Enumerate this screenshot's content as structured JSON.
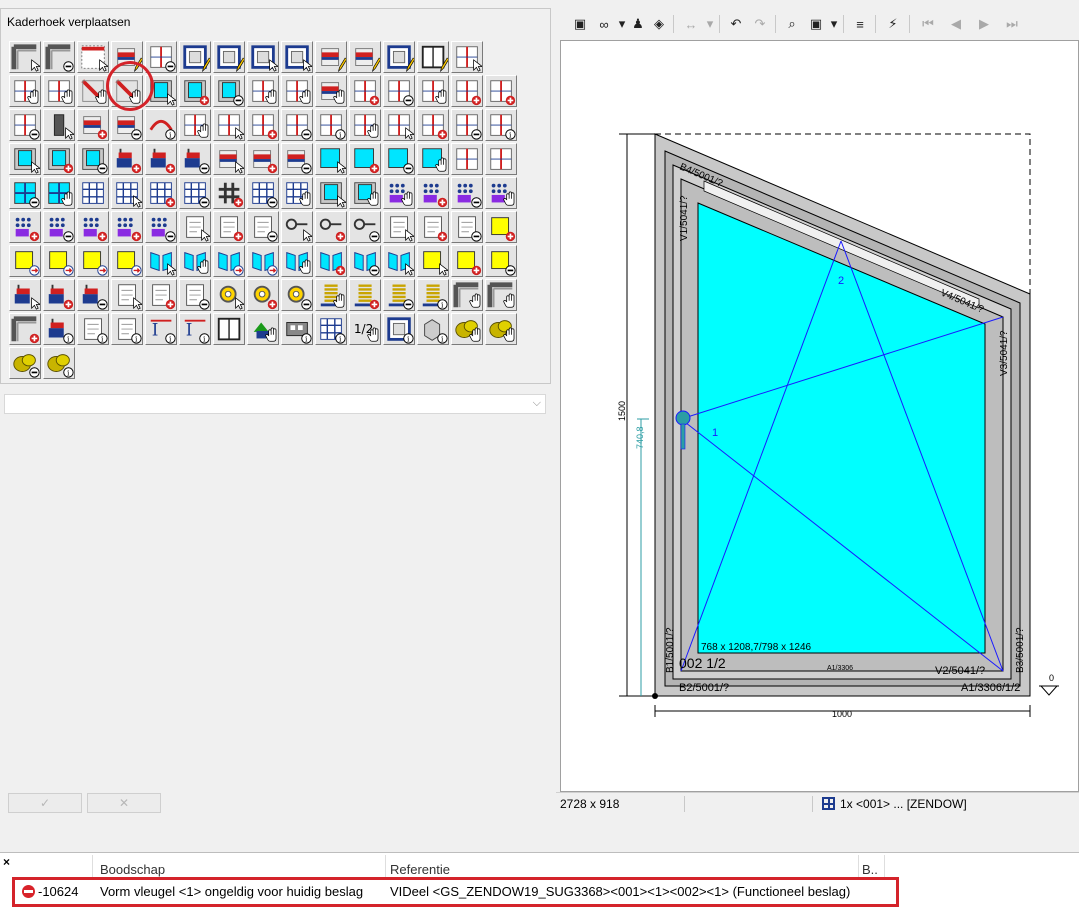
{
  "palette": {
    "title": "Kaderhoek verplaatsen",
    "tools": [
      {
        "row": 0,
        "col": 0,
        "kind": "corner",
        "badge": "cursor"
      },
      {
        "row": 0,
        "col": 1,
        "kind": "corner",
        "badge": "minus"
      },
      {
        "row": 0,
        "col": 2,
        "kind": "frame-red",
        "badge": "cursor"
      },
      {
        "row": 0,
        "col": 3,
        "kind": "bar-red",
        "badge": "pencil"
      },
      {
        "row": 0,
        "col": 4,
        "kind": "split",
        "badge": "minus"
      },
      {
        "row": 0,
        "col": 5,
        "kind": "frame-blue",
        "badge": "pencil"
      },
      {
        "row": 0,
        "col": 6,
        "kind": "frame-blue",
        "badge": "pencil"
      },
      {
        "row": 0,
        "col": 7,
        "kind": "frame-blue",
        "badge": "cursor"
      },
      {
        "row": 0,
        "col": 8,
        "kind": "frame-blue",
        "badge": "cursor"
      },
      {
        "row": 0,
        "col": 9,
        "kind": "bar-red",
        "badge": "pencil"
      },
      {
        "row": 0,
        "col": 10,
        "kind": "bar-red",
        "badge": "pencil"
      },
      {
        "row": 0,
        "col": 11,
        "kind": "frame-blue",
        "badge": "pencil"
      },
      {
        "row": 0,
        "col": 12,
        "kind": "window",
        "badge": "pencil"
      },
      {
        "row": 0,
        "col": 13,
        "kind": "split",
        "badge": "cursor"
      },
      {
        "row": 1,
        "col": 0,
        "kind": "split",
        "badge": "hand"
      },
      {
        "row": 1,
        "col": 1,
        "kind": "split",
        "badge": "hand"
      },
      {
        "row": 1,
        "col": 2,
        "kind": "diag-red",
        "badge": "hand"
      },
      {
        "row": 1,
        "col": 3,
        "kind": "diag-red",
        "badge": "hand"
      },
      {
        "row": 1,
        "col": 4,
        "kind": "cyan-frame",
        "badge": "cursor"
      },
      {
        "row": 1,
        "col": 5,
        "kind": "cyan-frame",
        "badge": "plus"
      },
      {
        "row": 1,
        "col": 6,
        "kind": "cyan-frame",
        "badge": "minus"
      },
      {
        "row": 1,
        "col": 7,
        "kind": "split",
        "badge": "hand"
      },
      {
        "row": 1,
        "col": 8,
        "kind": "split",
        "badge": "hand"
      },
      {
        "row": 1,
        "col": 9,
        "kind": "bar-red",
        "badge": "hand"
      },
      {
        "row": 1,
        "col": 10,
        "kind": "split",
        "badge": "plus"
      },
      {
        "row": 1,
        "col": 11,
        "kind": "split",
        "badge": "minus"
      },
      {
        "row": 1,
        "col": 12,
        "kind": "split",
        "badge": "hand"
      },
      {
        "row": 1,
        "col": 13,
        "kind": "split",
        "badge": "plus"
      },
      {
        "row": 1,
        "col": 14,
        "kind": "split",
        "badge": "plus"
      },
      {
        "row": 2,
        "col": 0,
        "kind": "split",
        "badge": "minus"
      },
      {
        "row": 2,
        "col": 1,
        "kind": "bar-dark",
        "badge": "cursor"
      },
      {
        "row": 2,
        "col": 2,
        "kind": "bar-red",
        "badge": "plus"
      },
      {
        "row": 2,
        "col": 3,
        "kind": "bar-red",
        "badge": "minus"
      },
      {
        "row": 2,
        "col": 4,
        "kind": "arc",
        "badge": "info"
      },
      {
        "row": 2,
        "col": 5,
        "kind": "split",
        "badge": "hand"
      },
      {
        "row": 2,
        "col": 6,
        "kind": "split",
        "badge": "cursor"
      },
      {
        "row": 2,
        "col": 7,
        "kind": "split",
        "badge": "plus"
      },
      {
        "row": 2,
        "col": 8,
        "kind": "split",
        "badge": "minus"
      },
      {
        "row": 2,
        "col": 9,
        "kind": "split",
        "badge": "info"
      },
      {
        "row": 2,
        "col": 10,
        "kind": "split",
        "badge": "hand"
      },
      {
        "row": 2,
        "col": 11,
        "kind": "split",
        "badge": "cursor"
      },
      {
        "row": 2,
        "col": 12,
        "kind": "split",
        "badge": "plus"
      },
      {
        "row": 2,
        "col": 13,
        "kind": "split",
        "badge": "minus"
      },
      {
        "row": 2,
        "col": 14,
        "kind": "split",
        "badge": "info"
      },
      {
        "row": 3,
        "col": 0,
        "kind": "cyan-frame",
        "badge": "cursor"
      },
      {
        "row": 3,
        "col": 1,
        "kind": "cyan-frame",
        "badge": "plus"
      },
      {
        "row": 3,
        "col": 2,
        "kind": "cyan-frame",
        "badge": "minus"
      },
      {
        "row": 3,
        "col": 3,
        "kind": "stack",
        "badge": "plus"
      },
      {
        "row": 3,
        "col": 4,
        "kind": "stack",
        "badge": "plus"
      },
      {
        "row": 3,
        "col": 5,
        "kind": "stack",
        "badge": "minus"
      },
      {
        "row": 3,
        "col": 6,
        "kind": "bar-red",
        "badge": "cursor"
      },
      {
        "row": 3,
        "col": 7,
        "kind": "bar-red",
        "badge": "plus"
      },
      {
        "row": 3,
        "col": 8,
        "kind": "bar-red",
        "badge": "minus"
      },
      {
        "row": 3,
        "col": 9,
        "kind": "cyan",
        "badge": "cursor"
      },
      {
        "row": 3,
        "col": 10,
        "kind": "cyan",
        "badge": "plus"
      },
      {
        "row": 3,
        "col": 11,
        "kind": "cyan",
        "badge": "minus"
      },
      {
        "row": 3,
        "col": 12,
        "kind": "cyan",
        "badge": "hand"
      },
      {
        "row": 3,
        "col": 13,
        "kind": "split",
        "badge": "none"
      },
      {
        "row": 3,
        "col": 14,
        "kind": "split",
        "badge": "none"
      },
      {
        "row": 4,
        "col": 0,
        "kind": "cyan-cross",
        "badge": "minus"
      },
      {
        "row": 4,
        "col": 1,
        "kind": "cyan-cross",
        "badge": "hand"
      },
      {
        "row": 4,
        "col": 2,
        "kind": "grid",
        "badge": "none"
      },
      {
        "row": 4,
        "col": 3,
        "kind": "grid",
        "badge": "cursor"
      },
      {
        "row": 4,
        "col": 4,
        "kind": "grid",
        "badge": "plus"
      },
      {
        "row": 4,
        "col": 5,
        "kind": "grid",
        "badge": "minus"
      },
      {
        "row": 4,
        "col": 6,
        "kind": "grid-dark",
        "badge": "plus"
      },
      {
        "row": 4,
        "col": 7,
        "kind": "grid",
        "badge": "minus"
      },
      {
        "row": 4,
        "col": 8,
        "kind": "grid",
        "badge": "hand"
      },
      {
        "row": 4,
        "col": 9,
        "kind": "cyan-frame",
        "badge": "cursor"
      },
      {
        "row": 4,
        "col": 10,
        "kind": "cyan-frame",
        "badge": "hand"
      },
      {
        "row": 4,
        "col": 11,
        "kind": "dots",
        "badge": "hand"
      },
      {
        "row": 4,
        "col": 12,
        "kind": "dots",
        "badge": "plus"
      },
      {
        "row": 4,
        "col": 13,
        "kind": "dots",
        "badge": "minus"
      },
      {
        "row": 4,
        "col": 14,
        "kind": "dots",
        "badge": "hand"
      },
      {
        "row": 5,
        "col": 0,
        "kind": "dots",
        "badge": "plus"
      },
      {
        "row": 5,
        "col": 1,
        "kind": "dots",
        "badge": "minus"
      },
      {
        "row": 5,
        "col": 2,
        "kind": "dots",
        "badge": "plus"
      },
      {
        "row": 5,
        "col": 3,
        "kind": "dots",
        "badge": "plus"
      },
      {
        "row": 5,
        "col": 4,
        "kind": "dots",
        "badge": "minus"
      },
      {
        "row": 5,
        "col": 5,
        "kind": "sheet",
        "badge": "cursor"
      },
      {
        "row": 5,
        "col": 6,
        "kind": "sheet",
        "badge": "plus"
      },
      {
        "row": 5,
        "col": 7,
        "kind": "sheet",
        "badge": "minus"
      },
      {
        "row": 5,
        "col": 8,
        "kind": "key",
        "badge": "cursor"
      },
      {
        "row": 5,
        "col": 9,
        "kind": "key",
        "badge": "plus"
      },
      {
        "row": 5,
        "col": 10,
        "kind": "key",
        "badge": "minus"
      },
      {
        "row": 5,
        "col": 11,
        "kind": "sheet",
        "badge": "cursor"
      },
      {
        "row": 5,
        "col": 12,
        "kind": "sheet",
        "badge": "plus"
      },
      {
        "row": 5,
        "col": 13,
        "kind": "sheet",
        "badge": "minus"
      },
      {
        "row": 5,
        "col": 14,
        "kind": "yellow",
        "badge": "plus"
      },
      {
        "row": 6,
        "col": 0,
        "kind": "yellow",
        "badge": "arrow"
      },
      {
        "row": 6,
        "col": 1,
        "kind": "yellow",
        "badge": "arrow"
      },
      {
        "row": 6,
        "col": 2,
        "kind": "yellow",
        "badge": "arrow"
      },
      {
        "row": 6,
        "col": 3,
        "kind": "yellow",
        "badge": "arrow"
      },
      {
        "row": 6,
        "col": 4,
        "kind": "book",
        "badge": "cursor"
      },
      {
        "row": 6,
        "col": 5,
        "kind": "book",
        "badge": "hand"
      },
      {
        "row": 6,
        "col": 6,
        "kind": "book",
        "badge": "arrow"
      },
      {
        "row": 6,
        "col": 7,
        "kind": "book",
        "badge": "arrow"
      },
      {
        "row": 6,
        "col": 8,
        "kind": "book",
        "badge": "hand"
      },
      {
        "row": 6,
        "col": 9,
        "kind": "book",
        "badge": "plus"
      },
      {
        "row": 6,
        "col": 10,
        "kind": "book",
        "badge": "minus"
      },
      {
        "row": 6,
        "col": 11,
        "kind": "book",
        "badge": "cursor"
      },
      {
        "row": 6,
        "col": 12,
        "kind": "yellow",
        "badge": "cursor"
      },
      {
        "row": 6,
        "col": 13,
        "kind": "yellow",
        "badge": "plus"
      },
      {
        "row": 6,
        "col": 14,
        "kind": "yellow",
        "badge": "minus"
      },
      {
        "row": 7,
        "col": 0,
        "kind": "stack",
        "badge": "cursor"
      },
      {
        "row": 7,
        "col": 1,
        "kind": "stack",
        "badge": "plus"
      },
      {
        "row": 7,
        "col": 2,
        "kind": "stack",
        "badge": "minus"
      },
      {
        "row": 7,
        "col": 3,
        "kind": "sheet",
        "badge": "cursor"
      },
      {
        "row": 7,
        "col": 4,
        "kind": "sheet",
        "badge": "plus"
      },
      {
        "row": 7,
        "col": 5,
        "kind": "sheet",
        "badge": "minus"
      },
      {
        "row": 7,
        "col": 6,
        "kind": "gear",
        "badge": "cursor"
      },
      {
        "row": 7,
        "col": 7,
        "kind": "gear",
        "badge": "plus"
      },
      {
        "row": 7,
        "col": 8,
        "kind": "gear",
        "badge": "minus"
      },
      {
        "row": 7,
        "col": 9,
        "kind": "spring",
        "badge": "hand"
      },
      {
        "row": 7,
        "col": 10,
        "kind": "spring",
        "badge": "plus"
      },
      {
        "row": 7,
        "col": 11,
        "kind": "spring",
        "badge": "minus"
      },
      {
        "row": 7,
        "col": 12,
        "kind": "spring",
        "badge": "info"
      },
      {
        "row": 7,
        "col": 13,
        "kind": "corner",
        "badge": "hand"
      },
      {
        "row": 7,
        "col": 14,
        "kind": "corner",
        "badge": "hand"
      },
      {
        "row": 8,
        "col": 0,
        "kind": "corner",
        "badge": "plus"
      },
      {
        "row": 8,
        "col": 1,
        "kind": "stack",
        "badge": "info"
      },
      {
        "row": 8,
        "col": 2,
        "kind": "sheet",
        "badge": "info"
      },
      {
        "row": 8,
        "col": 3,
        "kind": "sheet",
        "badge": "info"
      },
      {
        "row": 8,
        "col": 4,
        "kind": "ibeam",
        "badge": "info"
      },
      {
        "row": 8,
        "col": 5,
        "kind": "ibeam",
        "badge": "info"
      },
      {
        "row": 8,
        "col": 6,
        "kind": "window",
        "badge": "none"
      },
      {
        "row": 8,
        "col": 7,
        "kind": "green",
        "badge": "hand"
      },
      {
        "row": 8,
        "col": 8,
        "kind": "profile",
        "badge": "info"
      },
      {
        "row": 8,
        "col": 9,
        "kind": "grid",
        "badge": "info"
      },
      {
        "row": 8,
        "col": 10,
        "kind": "half",
        "badge": "hand"
      },
      {
        "row": 8,
        "col": 11,
        "kind": "frame-blue",
        "badge": "info"
      },
      {
        "row": 8,
        "col": 12,
        "kind": "box",
        "badge": "info"
      },
      {
        "row": 8,
        "col": 13,
        "kind": "coins",
        "badge": "hand"
      },
      {
        "row": 8,
        "col": 14,
        "kind": "coins",
        "badge": "hand"
      },
      {
        "row": 9,
        "col": 0,
        "kind": "coins",
        "badge": "minus"
      },
      {
        "row": 9,
        "col": 1,
        "kind": "coins",
        "badge": "info"
      }
    ]
  },
  "toolbar": {
    "items": [
      {
        "name": "view-button-icon",
        "glyph": "▣",
        "disabled": false
      },
      {
        "name": "glasses-icon",
        "glyph": "∞",
        "disabled": false
      },
      {
        "name": "dropdown-arrow-icon",
        "glyph": "▾",
        "disabled": false
      },
      {
        "name": "person-icon",
        "glyph": "♟",
        "disabled": false
      },
      {
        "name": "layers-icon",
        "glyph": "◈",
        "disabled": false
      },
      {
        "name": "dimension-icon",
        "glyph": "↔",
        "disabled": true
      },
      {
        "name": "dropdown-arrow-icon",
        "glyph": "▾",
        "disabled": true
      },
      {
        "name": "undo-icon",
        "glyph": "↶",
        "disabled": false
      },
      {
        "name": "redo-icon",
        "glyph": "↷",
        "disabled": true
      },
      {
        "name": "zoom-icon",
        "glyph": "⌕",
        "disabled": false
      },
      {
        "name": "frame-select-icon",
        "glyph": "▣",
        "disabled": false
      },
      {
        "name": "dropdown-arrow-icon",
        "glyph": "▾",
        "disabled": false
      },
      {
        "name": "align-left-icon",
        "glyph": "≡",
        "disabled": false
      },
      {
        "name": "lightning-check-icon",
        "glyph": "⚡",
        "disabled": false
      },
      {
        "name": "first-page-icon",
        "glyph": "⏮",
        "disabled": true
      },
      {
        "name": "previous-icon",
        "glyph": "◀",
        "disabled": true
      },
      {
        "name": "next-icon",
        "glyph": "▶",
        "disabled": true
      },
      {
        "name": "last-page-icon",
        "glyph": "⏭",
        "disabled": true
      }
    ]
  },
  "drawing": {
    "labels": {
      "top_frame": "B4/5001/?",
      "left_inner": "V1/5041/?",
      "right_frame": "B3/5001/?",
      "right_inner": "V3/5041/?",
      "top_right_inner": "V4/5041/?",
      "bottom_left": "B1/5001/?",
      "bottom_frame": "B2/5001/?",
      "bottom_right": "A1/3306/1/2",
      "bottom_inner": "V2/5041/?",
      "bottom_small": "A1/3306",
      "sash_left": "002 1/2",
      "sash_dims": "768 x 1208,7/798 x 1246",
      "height_dim": "1500",
      "handle_dim": "740,8",
      "width_dim": "1000",
      "level_mark": "0",
      "point_1": "1",
      "point_2": "2"
    }
  },
  "status": {
    "size": "2728 x 918",
    "document": "1x <001> ... [ZENDOW]"
  },
  "messages": {
    "columns": [
      "",
      "Boodschap",
      "Referentie",
      "B.."
    ],
    "rows": [
      {
        "code": "-10624",
        "message": "Vorm vleugel <1> ongeldig voor huidig beslag",
        "reference": "VIDeel <GS_ZENDOW19_SUG3368><001><1><002><1> (Functioneel beslag)"
      }
    ]
  },
  "colors": {
    "glass": "#00ffff",
    "frame": "#c0c0c0",
    "error": "#d4232a",
    "line": "#1a1aff"
  }
}
